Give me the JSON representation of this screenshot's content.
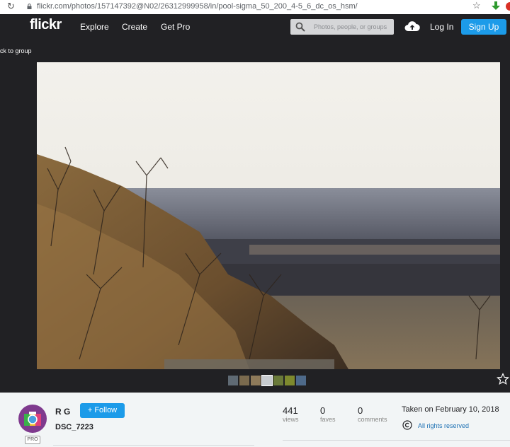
{
  "browser": {
    "url": "flickr.com/photos/157147392@N02/26312999958/in/pool-sigma_50_200_4-5_6_dc_os_hsm/"
  },
  "header": {
    "logo": "flickr",
    "nav": [
      "Explore",
      "Create",
      "Get Pro"
    ],
    "search_placeholder": "Photos, people, or groups",
    "login": "Log In",
    "signup": "Sign Up"
  },
  "viewer": {
    "back_link": "ck to group",
    "thumbnails": [
      "thumb-1",
      "thumb-2",
      "thumb-3",
      "thumb-4",
      "thumb-5",
      "thumb-6",
      "thumb-7"
    ]
  },
  "owner": {
    "name": "R G",
    "follow_label": "+ Follow",
    "pro_badge": "PRO"
  },
  "photo": {
    "title": "DSC_7223"
  },
  "stats": [
    {
      "value": "441",
      "label": "views"
    },
    {
      "value": "0",
      "label": "faves"
    },
    {
      "value": "0",
      "label": "comments"
    }
  ],
  "meta": {
    "taken": "Taken on February 10, 2018",
    "rights": "All rights reserved"
  },
  "colors": {
    "header_bg": "#212124",
    "accent": "#1c9be9",
    "link": "#1c70b3"
  }
}
